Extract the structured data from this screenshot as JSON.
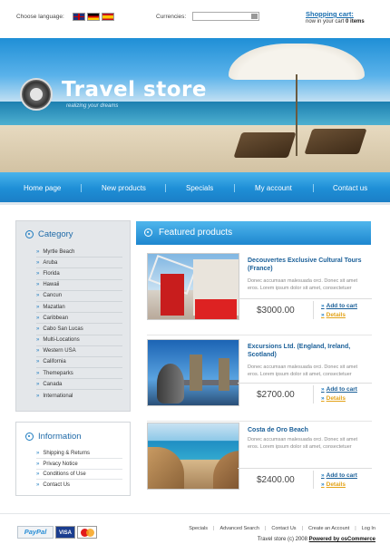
{
  "topbar": {
    "language_label": "Choose language:",
    "flags": [
      "uk-flag-icon",
      "de-flag-icon",
      "es-flag-icon"
    ],
    "currencies_label": "Currencies:",
    "currencies_value": "",
    "cart_title": "Shopping cart:",
    "cart_status_prefix": "now in your cart",
    "cart_status_count": "0 items"
  },
  "banner": {
    "title": "Travel store",
    "tagline": "realizing your dreams"
  },
  "nav": [
    "Home page",
    "New products",
    "Specials",
    "My account",
    "Contact us"
  ],
  "category": {
    "title": "Category",
    "items": [
      "Myrtle Beach",
      "Aruba",
      "Florida",
      "Hawaii",
      "Cancun",
      "Mazatlan",
      "Caribbean",
      "Cabo San Lucas",
      "Multi-Locations",
      "Western USA",
      "California",
      "Themeparks",
      "Canada",
      "International"
    ]
  },
  "information": {
    "title": "Information",
    "items": [
      "Shipping & Returns",
      "Privacy Notice",
      "Conditions of Use",
      "Contact Us"
    ]
  },
  "featured": {
    "title": "Featured products",
    "products": [
      {
        "name": "Decouvertes Exclusive Cultural Tours (France)",
        "desc": "Donec accumsan malesuada orci. Donec sit amet eros. Lorem ipsum dolor sit amet, consectetuer",
        "price": "$3000.00",
        "add_label": "Add to cart",
        "details_label": "Details"
      },
      {
        "name": "Excursions Ltd. (England, Ireland, Scotland)",
        "desc": "Donec accumsan malesuada orci. Donec sit amet eros. Lorem ipsum dolor sit amet, consectetuer",
        "price": "$2700.00",
        "add_label": "Add to cart",
        "details_label": "Details"
      },
      {
        "name": "Costa de Oro Beach",
        "desc": "Donec accumsan malesuada orci. Donec sit amet eros. Lorem ipsum dolor sit amet, consectetuer",
        "price": "$2400.00",
        "add_label": "Add to cart",
        "details_label": "Details"
      }
    ]
  },
  "footer": {
    "links": [
      "Specials",
      "Advanced Search",
      "Contact Us",
      "Create an Account",
      "Log In"
    ],
    "copyright": "Travel store (c) 2008",
    "powered": "Powered by osCommerce",
    "paypal_logo": "PayPal",
    "visa_logo": "VISA"
  }
}
